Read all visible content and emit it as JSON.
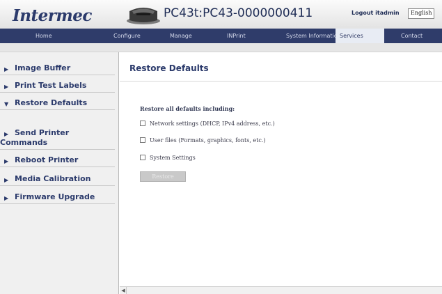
{
  "header": {
    "logo_text": "Intermec",
    "printer_title": "PC43t:PC43-0000000411",
    "logout_label": "Logout itadmin",
    "language_selected": "English"
  },
  "nav": {
    "items": [
      "Home",
      "Configure",
      "Manage",
      "INPrint",
      "System Information",
      "Services",
      "Contact"
    ],
    "active": "Services"
  },
  "sidebar": {
    "items": [
      "Image Buffer",
      "Print Test Labels",
      "Restore Defaults",
      "Send Printer",
      "Commands",
      "Reboot Printer",
      "Media Calibration",
      "Firmware Upgrade"
    ],
    "active": "Restore Defaults"
  },
  "content": {
    "title": "Restore Defaults",
    "section_label": "Restore all defaults including:",
    "options": [
      "Network settings (DHCP, IPv4 address, etc.)",
      "User files (Formats, graphics, fonts, etc.)",
      "System Settings"
    ],
    "button_label": "Restore"
  },
  "colors": {
    "nav_bg": "#2f3c6a",
    "brand_blue": "#2b3a6b"
  }
}
